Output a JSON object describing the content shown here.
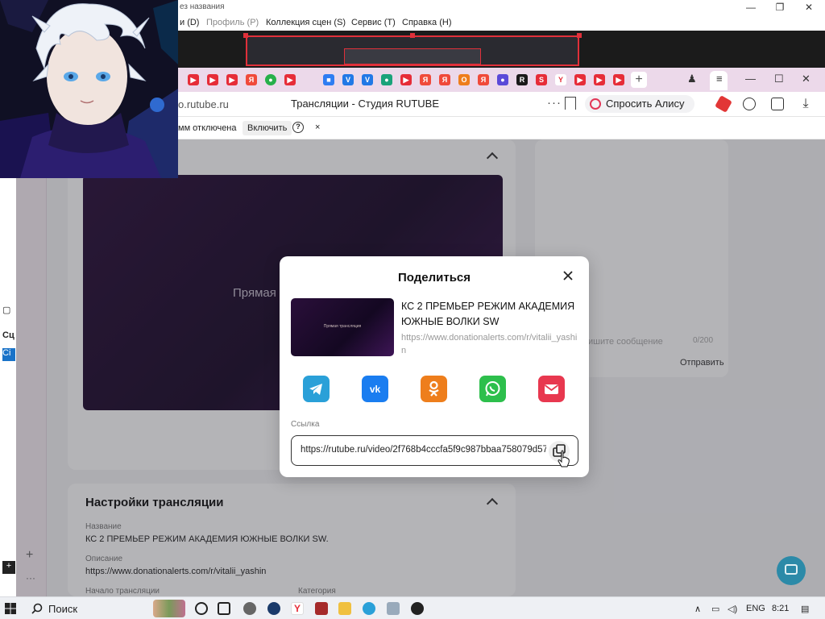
{
  "obs": {
    "title_fragment": "ез названия",
    "menu": [
      {
        "label": "и (D)",
        "dim": false
      },
      {
        "label": "Профиль (P)",
        "dim": true
      },
      {
        "label": "Коллекция сцен (S)",
        "dim": false
      },
      {
        "label": "Сервис (T)",
        "dim": false
      },
      {
        "label": "Справка (H)",
        "dim": false
      }
    ],
    "window_controls": [
      "—",
      "❐",
      "✕"
    ]
  },
  "browser": {
    "url": "o.rutube.ru",
    "page_title": "Трансляции - Студия RUTUBE",
    "alisa_label": "Спросить Алису AI",
    "window_controls": [
      "⋮",
      "≡",
      "—",
      "☐",
      "✕"
    ],
    "infobar": {
      "text": "мм отключена",
      "enable_label": "Включить",
      "help": "?",
      "close": "×"
    }
  },
  "page": {
    "video_label": "Прямая",
    "chat": {
      "placeholder": "ишите сообщение",
      "counter": "0/200",
      "send_label": "Отправить"
    },
    "settings": {
      "heading": "Настройки трансляции",
      "name_label": "Название",
      "name_value": "КС 2 ПРЕМЬЕР РЕЖИМ АКАДЕМИЯ ЮЖНЫЕ ВОЛКИ SW.",
      "desc_label": "Описание",
      "desc_value": "https://www.donationalerts.com/r/vitalii_yashin",
      "start_label": "Начало трансляции",
      "category_label": "Категория"
    }
  },
  "modal": {
    "title": "Поделиться",
    "video_title": "КС 2 ПРЕМЬЕР РЕЖИМ АКАДЕМИЯ ЮЖНЫЕ ВОЛКИ SW",
    "video_url": "https://www.donationalerts.com/r/vitalii_yashin",
    "thumb_label": "Прямая трансляция",
    "link_label": "Ссылка",
    "link_value": "https://rutube.ru/video/2f768b4cccfa5f9c987bbaa758079d57/",
    "share_targets": [
      {
        "name": "telegram",
        "color": "#2aa0d8"
      },
      {
        "name": "vk",
        "color": "#1a7df0"
      },
      {
        "name": "odnoklassniki",
        "color": "#ee7e1c"
      },
      {
        "name": "whatsapp",
        "color": "#2dbf4c"
      },
      {
        "name": "email",
        "color": "#e8384f"
      }
    ]
  },
  "taskbar": {
    "search_label": "Поиск",
    "lang": "ENG",
    "time": "8:21"
  },
  "colors": {
    "accent_red": "#e0303a",
    "help_fab": "#2c8aa8"
  }
}
